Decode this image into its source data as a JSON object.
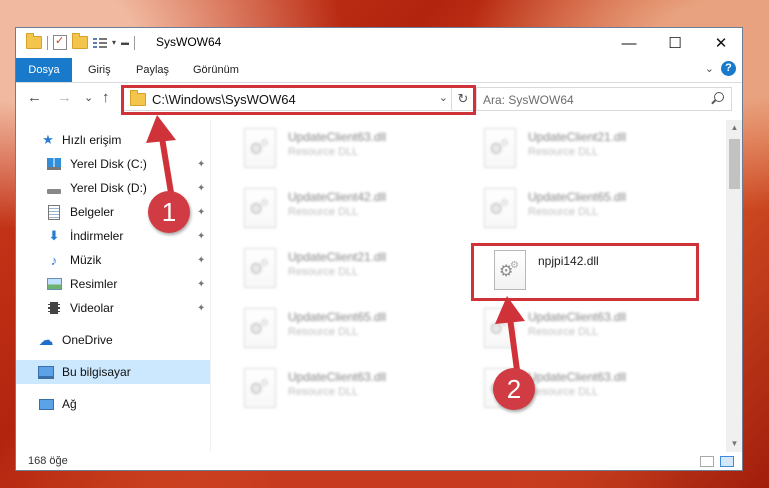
{
  "window": {
    "title": "SysWOW64",
    "minimize_glyph": "—",
    "maximize_glyph": "☐",
    "close_glyph": "✕"
  },
  "ribbon": {
    "tabs": [
      "Dosya",
      "Giriş",
      "Paylaş",
      "Görünüm"
    ],
    "expand_glyph": "⌄"
  },
  "nav": {
    "back_glyph": "←",
    "forward_glyph": "→",
    "recent_glyph": "⌄",
    "up_glyph": "↑",
    "address": "C:\\Windows\\SysWOW64",
    "address_dropdown_glyph": "⌄",
    "refresh_glyph": "↻",
    "search_placeholder": "Ara: SysWOW64"
  },
  "sidebar": {
    "items": [
      {
        "label": "Hızlı erişim",
        "icon": "star-icon",
        "pinned": false,
        "selected": false
      },
      {
        "label": "Yerel Disk (C:)",
        "icon": "windows-drive-icon",
        "pinned": true,
        "selected": false
      },
      {
        "label": "Yerel Disk (D:)",
        "icon": "drive-icon",
        "pinned": true,
        "selected": false
      },
      {
        "label": "Belgeler",
        "icon": "document-icon",
        "pinned": true,
        "selected": false
      },
      {
        "label": "İndirmeler",
        "icon": "download-icon",
        "pinned": true,
        "selected": false
      },
      {
        "label": "Müzik",
        "icon": "music-icon",
        "pinned": true,
        "selected": false
      },
      {
        "label": "Resimler",
        "icon": "picture-icon",
        "pinned": true,
        "selected": false
      },
      {
        "label": "Videolar",
        "icon": "video-icon",
        "pinned": true,
        "selected": false
      },
      {
        "label": "OneDrive",
        "icon": "cloud-icon",
        "pinned": false,
        "selected": false
      },
      {
        "label": "Bu bilgisayar",
        "icon": "computer-icon",
        "pinned": false,
        "selected": true
      },
      {
        "label": "Ağ",
        "icon": "network-icon",
        "pinned": false,
        "selected": false
      }
    ],
    "pin_glyph": "📌"
  },
  "files": [
    {
      "name": "UpdateClient63.dll",
      "type": "Resource DLL",
      "blurred": true
    },
    {
      "name": "UpdateClient21.dll",
      "type": "Resource DLL",
      "blurred": true
    },
    {
      "name": "UpdateClient42.dll",
      "type": "Resource DLL",
      "blurred": true
    },
    {
      "name": "UpdateClient65.dll",
      "type": "Resource DLL",
      "blurred": true
    },
    {
      "name": "UpdateClient21.dll",
      "type": "Resource DLL",
      "blurred": true
    },
    {
      "name": "npjpi142.dll",
      "type": "",
      "blurred": false
    },
    {
      "name": "UpdateClient65.dll",
      "type": "Resource DLL",
      "blurred": true
    },
    {
      "name": "UpdateClient63.dll",
      "type": "Resource DLL",
      "blurred": true
    },
    {
      "name": "UpdateClient63.dll",
      "type": "Resource DLL",
      "blurred": true
    },
    {
      "name": "UpdateClient63.dll",
      "type": "Resource DLL",
      "blurred": true
    }
  ],
  "status": {
    "item_count": "168 öğe"
  },
  "annotations": {
    "step1": "1",
    "step2": "2",
    "accent_color": "#d0323a"
  },
  "colors": {
    "ribbon_active": "#1979ca",
    "selection": "#cce8ff"
  }
}
